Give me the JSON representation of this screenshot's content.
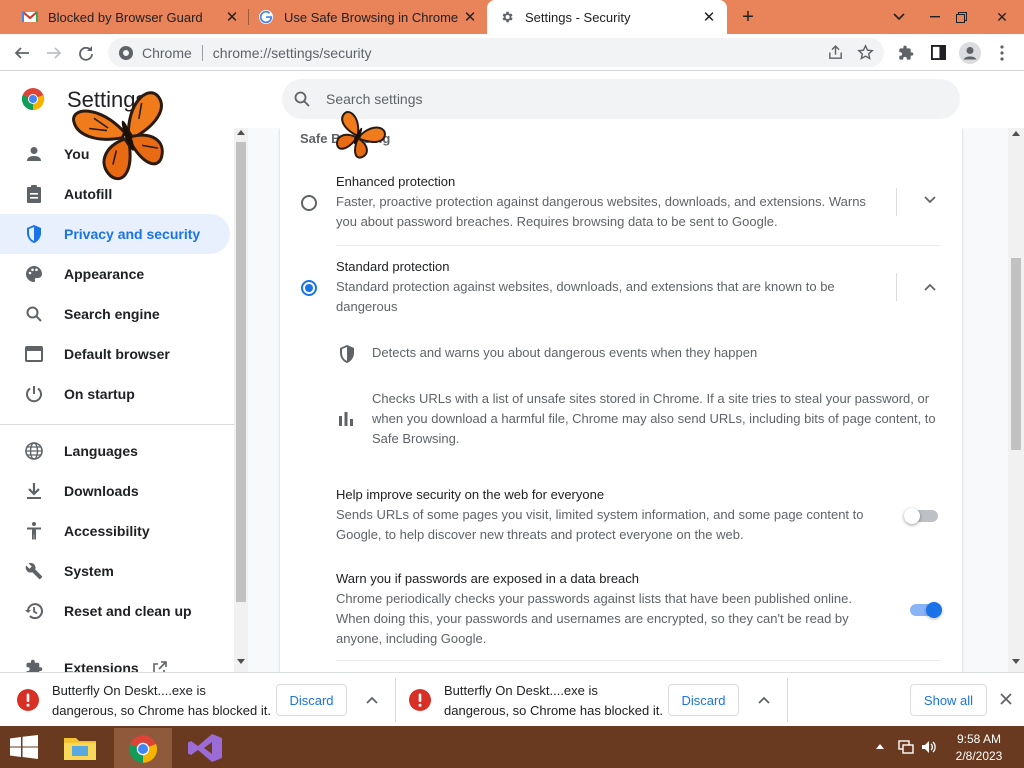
{
  "tabs": [
    {
      "title": "Blocked by Browser Guard",
      "icon": "gmail-icon"
    },
    {
      "title": "Use Safe Browsing in Chrome - C",
      "icon": "google-icon"
    },
    {
      "title": "Settings - Security",
      "icon": "gear-icon"
    }
  ],
  "toolbar": {
    "site_label": "Chrome",
    "url": "chrome://settings/security"
  },
  "settings_header": {
    "title": "Settings",
    "search_placeholder": "Search settings"
  },
  "sidebar": {
    "items": [
      {
        "label": "You",
        "icon": "person-icon"
      },
      {
        "label": "Autofill",
        "icon": "clipboard-icon"
      },
      {
        "label": "Privacy and security",
        "icon": "shield-icon"
      },
      {
        "label": "Appearance",
        "icon": "palette-icon"
      },
      {
        "label": "Search engine",
        "icon": "search-icon"
      },
      {
        "label": "Default browser",
        "icon": "browser-icon"
      },
      {
        "label": "On startup",
        "icon": "power-icon"
      },
      {
        "label": "Languages",
        "icon": "globe-icon"
      },
      {
        "label": "Downloads",
        "icon": "download-icon"
      },
      {
        "label": "Accessibility",
        "icon": "accessibility-icon"
      },
      {
        "label": "System",
        "icon": "wrench-icon"
      },
      {
        "label": "Reset and clean up",
        "icon": "history-icon"
      },
      {
        "label": "Extensions",
        "icon": "puzzle-icon"
      }
    ]
  },
  "main": {
    "section_title": "Safe Browsing",
    "enhanced": {
      "title": "Enhanced protection",
      "desc_line1": "Faster, proactive protection against dangerous websites, downloads, and extensions. Warns",
      "desc_line2": "you about password breaches. Requires browsing data to be sent to Google."
    },
    "standard": {
      "title": "Standard protection",
      "desc_line1": "Standard protection against websites, downloads, and extensions that are known to be",
      "desc_line2": "dangerous",
      "detail1": "Detects and warns you about dangerous events when they happen",
      "detail2_line1": "Checks URLs with a list of unsafe sites stored in Chrome. If a site tries to steal your password, or",
      "detail2_line2": "when you download a harmful file, Chrome may also send URLs, including bits of page content, to",
      "detail2_line3": "Safe Browsing."
    },
    "help_improve": {
      "title": "Help improve security on the web for everyone",
      "desc_line1": "Sends URLs of some pages you visit, limited system information, and some page content to",
      "desc_line2": "Google, to help discover new threats and protect everyone on the web.",
      "enabled": false
    },
    "password_warn": {
      "title": "Warn you if passwords are exposed in a data breach",
      "desc_line1": "Chrome periodically checks your passwords against lists that have been published online.",
      "desc_line2": "When doing this, your passwords and usernames are encrypted, so they can't be read by",
      "desc_line3": "anyone, including Google.",
      "enabled": true
    }
  },
  "downloads": [
    {
      "line1": "Butterfly On Deskt....exe is",
      "line2": "dangerous, so Chrome has blocked it.",
      "discard": "Discard"
    },
    {
      "line1": "Butterfly On Deskt....exe is",
      "line2": "dangerous, so Chrome has blocked it.",
      "discard": "Discard"
    }
  ],
  "downloads_show_all": "Show all",
  "taskbar": {
    "time": "9:58 AM",
    "date": "2/8/2023"
  },
  "colors": {
    "tabstrip": "#e8835a",
    "accent": "#1a73e8",
    "taskbar": "#6a3a20",
    "danger": "#d93025"
  }
}
